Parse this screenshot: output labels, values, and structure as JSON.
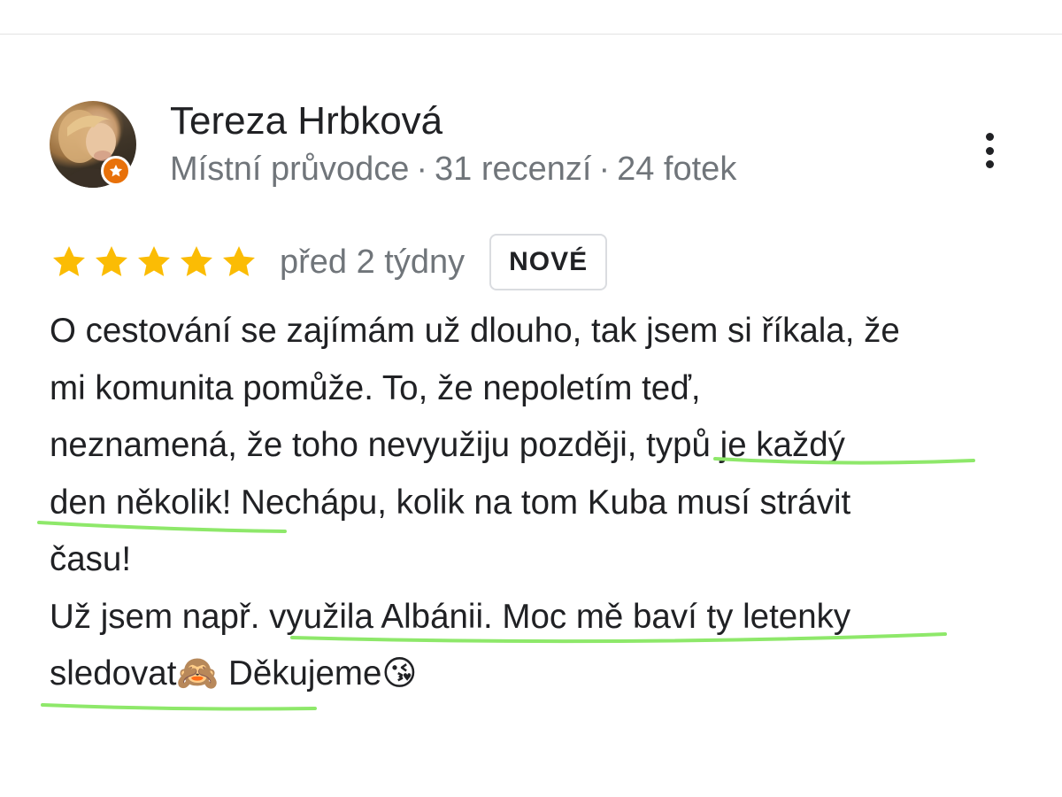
{
  "review": {
    "reviewer": {
      "name": "Tereza Hrbková",
      "badge_icon": "local-guide-star-icon",
      "meta": {
        "role": "Místní průvodce",
        "reviews": "31 recenzí",
        "photos": "24 fotek",
        "separator": "·"
      }
    },
    "rating": 5,
    "time": "před 2 týdny",
    "new_label": "NOVÉ",
    "text_lines": [
      "O cestování se zajímám už dlouho, tak jsem si říkala, že",
      "mi komunita pomůže. To, že nepoletím teď,",
      "neznamená, že toho nevyužiju později, typů je každý",
      "den několik! Nechápu, kolik na tom Kuba musí strávit",
      "času!",
      "Už jsem např. využila Albánii. Moc mě baví ty letenky",
      "sledovat🙈 Děkujeme😘"
    ]
  },
  "colors": {
    "star": "#fbbc04",
    "badge": "#e8710a",
    "highlight": "#8ee86a",
    "meta_text": "#70757a",
    "main_text": "#202124"
  },
  "icons": {
    "more": "more-vert-icon",
    "star": "star-icon"
  }
}
